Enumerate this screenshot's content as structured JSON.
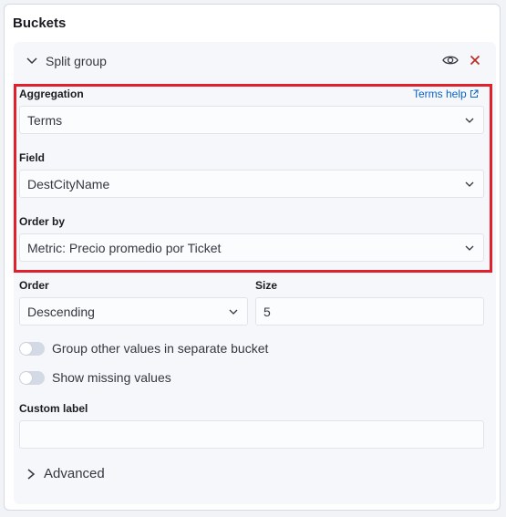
{
  "panel": {
    "title": "Buckets"
  },
  "split_group": {
    "title": "Split group"
  },
  "aggregation": {
    "label": "Aggregation",
    "help_link": "Terms help",
    "value": "Terms"
  },
  "field": {
    "label": "Field",
    "value": "DestCityName"
  },
  "order_by": {
    "label": "Order by",
    "value": "Metric: Precio promedio por Ticket"
  },
  "order": {
    "label": "Order",
    "value": "Descending"
  },
  "size": {
    "label": "Size",
    "value": "5"
  },
  "toggles": {
    "group_other": "Group other values in separate bucket",
    "show_missing": "Show missing values"
  },
  "custom_label": {
    "label": "Custom label",
    "value": ""
  },
  "advanced": {
    "label": "Advanced"
  },
  "colors": {
    "highlight": "#e0202c",
    "link": "#0b64c9",
    "danger": "#bd271e"
  }
}
